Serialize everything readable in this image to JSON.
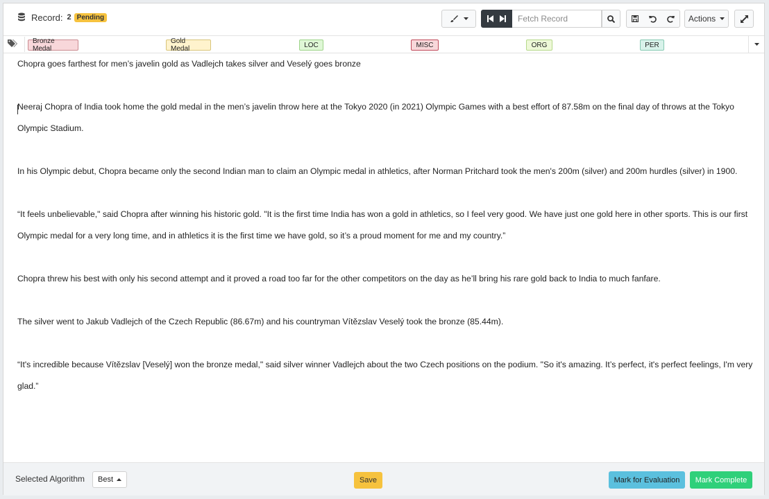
{
  "header": {
    "record_label": "Record:",
    "record_number": "2",
    "status_badge": "Pending",
    "fetch_placeholder": "Fetch Record",
    "actions_label": "Actions"
  },
  "tags": [
    {
      "label": "Bronze Medal",
      "bg": "#f8d7da",
      "border": "#c98a90"
    },
    {
      "label": "Gold Medal",
      "bg": "#fff3cd",
      "border": "#d8c47a"
    },
    {
      "label": "LOC",
      "bg": "#dff7d6",
      "border": "#9ed48a"
    },
    {
      "label": "MISC",
      "bg": "#f8d7da",
      "border": "#c04a5a"
    },
    {
      "label": "ORG",
      "bg": "#eef8d8",
      "border": "#b6d98a"
    },
    {
      "label": "PER",
      "bg": "#d8f2ea",
      "border": "#86c9b2"
    }
  ],
  "content": {
    "paragraphs": [
      "Chopra goes farthest for men’s javelin gold as Vadlejch takes silver and Veselý goes bronze",
      "Neeraj Chopra of India took home the gold medal in the men’s javelin throw here at the Tokyo 2020 (in 2021) Olympic Games with a best effort of 87.58m on the final day of throws at the Tokyo Olympic Stadium.",
      "In his Olympic debut, Chopra became only the second Indian man to claim an Olympic medal in athletics, after Norman Pritchard took the men's 200m (silver) and 200m hurdles (silver) in 1900.",
      "“It feels unbelievable,\" said Chopra after winning his historic gold. \"It is the first time India has won a gold in athletics, so I feel very good. We have just one gold here in other sports. This is our first Olympic medal for a very long time, and in athletics it is the first time we have gold, so it’s a proud moment for me and my country.”",
      "Chopra threw his best with only his second attempt and it proved a road too far for the other competitors on the day as he’ll bring his rare gold back to India to much fanfare.",
      "The silver went to Jakub Vadlejch of the Czech Republic (86.67m) and his countryman Vítězslav Veselý took the bronze (85.44m).",
      "“It's incredible because Vítězslav [Veselý] won the bronze medal,\" said silver winner Vadlejch about the two Czech positions on the podium. \"So it's amazing. It’s perfect, it's perfect feelings, I'm very glad.”"
    ]
  },
  "footer": {
    "algorithm_label": "Selected Algorithm",
    "algorithm_value": "Best",
    "save_label": "Save",
    "evaluation_label": "Mark for Evaluation",
    "complete_label": "Mark Complete"
  }
}
